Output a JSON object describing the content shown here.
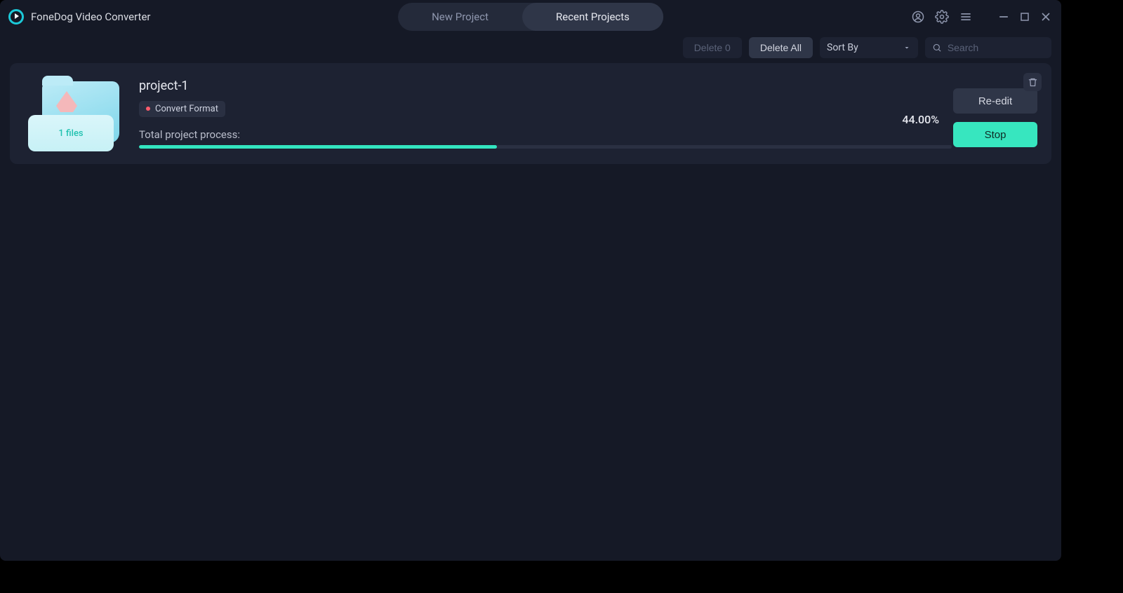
{
  "app": {
    "title": "FoneDog Video Converter"
  },
  "tabs": {
    "new": "New Project",
    "recent": "Recent Projects"
  },
  "toolbar": {
    "delete_count_label": "Delete 0",
    "delete_all_label": "Delete All",
    "sort_label": "Sort By",
    "search_placeholder": "Search"
  },
  "project": {
    "name": "project-1",
    "tag": "Convert Format",
    "file_count_label": "1 files",
    "progress_label": "Total project process:",
    "progress_pct_text": "44.00%",
    "progress_pct": 44,
    "reedit_label": "Re-edit",
    "stop_label": "Stop"
  }
}
